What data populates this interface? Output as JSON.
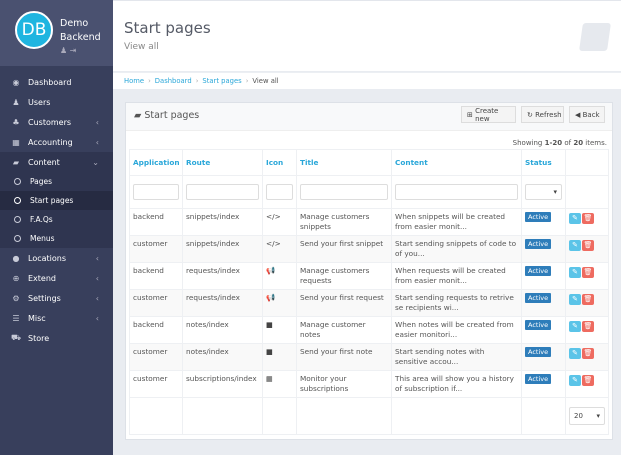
{
  "user": {
    "initials": "DB",
    "name_line1": "Demo",
    "name_line2": "Backend"
  },
  "sidebar": {
    "items": [
      {
        "label": "Dashboard",
        "icon": "dashboard-icon",
        "glyph": "◉",
        "chev": false
      },
      {
        "label": "Users",
        "icon": "user-icon",
        "glyph": "♟",
        "chev": false
      },
      {
        "label": "Customers",
        "icon": "users-icon",
        "glyph": "♣",
        "chev": true
      },
      {
        "label": "Accounting",
        "icon": "calculator-icon",
        "glyph": "▦",
        "chev": true
      },
      {
        "label": "Content",
        "icon": "book-icon",
        "glyph": "▰",
        "chev": false,
        "open": true
      },
      {
        "label": "Locations",
        "icon": "globe-icon",
        "glyph": "●",
        "chev": true
      },
      {
        "label": "Extend",
        "icon": "plus-circle-icon",
        "glyph": "⊕",
        "chev": true
      },
      {
        "label": "Settings",
        "icon": "cogs-icon",
        "glyph": "⚙",
        "chev": true
      },
      {
        "label": "Misc",
        "icon": "list-icon",
        "glyph": "☰",
        "chev": true
      },
      {
        "label": "Store",
        "icon": "cart-icon",
        "glyph": "⛟",
        "chev": false
      }
    ],
    "content_sub": [
      "Pages",
      "Start pages",
      "F.A.Qs",
      "Menus"
    ]
  },
  "header": {
    "title": "Start pages",
    "subtitle": "View all"
  },
  "breadcrumb": [
    "Home",
    "Dashboard",
    "Start pages",
    "View all"
  ],
  "panel": {
    "title": "Start pages",
    "create": "Create new",
    "refresh": "Refresh",
    "back": "Back",
    "showing_prefix": "Showing ",
    "showing_range": "1-20",
    "showing_of": " of ",
    "showing_total": "20",
    "showing_suffix": " items."
  },
  "table": {
    "columns": [
      "Application",
      "Route",
      "Icon",
      "Title",
      "Content",
      "Status"
    ],
    "rows": [
      {
        "app": "backend",
        "route": "snippets/index",
        "icon": "</>",
        "title": "Manage customers snippets",
        "content": "When snippets will be created from easier monit...",
        "status": "Active"
      },
      {
        "app": "customer",
        "route": "snippets/index",
        "icon": "</>",
        "title": "Send your first snippet",
        "content": "Start sending snippets of code to of you...",
        "status": "Active"
      },
      {
        "app": "backend",
        "route": "requests/index",
        "icon": "📢",
        "title": "Manage customers requests",
        "content": "When requests will be created from easier monit...",
        "status": "Active"
      },
      {
        "app": "customer",
        "route": "requests/index",
        "icon": "📢",
        "title": "Send your first request",
        "content": "Start sending requests to retrive se recipients wi...",
        "status": "Active"
      },
      {
        "app": "backend",
        "route": "notes/index",
        "icon": "■",
        "title": "Manage customer notes",
        "content": "When notes will be created from easier monitori...",
        "status": "Active"
      },
      {
        "app": "customer",
        "route": "notes/index",
        "icon": "■",
        "title": "Send your first note",
        "content": "Start sending notes with sensitive accou...",
        "status": "Active"
      },
      {
        "app": "customer",
        "route": "subscriptions/index",
        "icon": "▦",
        "title": "Monitor your subscriptions",
        "content": "This area will show you a history of subscription if...",
        "status": "Active"
      }
    ],
    "page_size": "20"
  }
}
